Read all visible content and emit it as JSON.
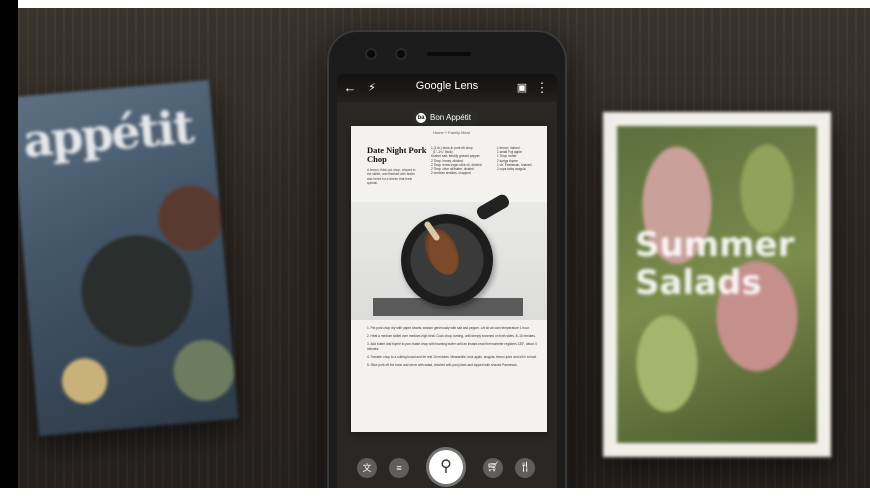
{
  "scene": {
    "left_magazine_title": "appétit",
    "right_magazine_title": "Summer Salads"
  },
  "app": {
    "title": "Google Lens",
    "back_icon": "arrow-left-icon",
    "flash_icon": "flash-off-icon",
    "gallery_icon": "gallery-icon",
    "menu_icon": "more-vert-icon"
  },
  "chip": {
    "logo": "ba",
    "label": "Bon Appétit"
  },
  "recipe": {
    "subheading": "Home + Family Meal",
    "title": "Date Night Pork Chop",
    "intro": "A brown, thick-cut chop, crisped in the skillet, and finished with butter and herbs for a dinner that feels special.",
    "ingredients_col1": "1 (1 lb.) bone-in pork rib chop\n  (1\"–1¼\" thick)\nKosher salt, freshly ground pepper\n2 Tbsp. honey, divided\n2 Tbsp. extra-virgin olive oil, divided\n2 Tbsp. olive oil/butter, divided\n2 medium shallots, chopped",
    "ingredients_col2": "1 lemon, halved\n1 small Fuji apple\n1 Tbsp. butter\n2 sprigs thyme\n1 oz. Parmesan, shaved\n2 cups baby arugula",
    "steps": [
      "1. Pat pork chop dry with paper towels; season generously with salt and pepper. Let sit at room temperature 1 hour.",
      "2. Heat a medium skillet over medium-high heat. Cook chop, turning, until deeply browned on both sides, 8–10 minutes.",
      "3. Add butter and thyme to pan; baste chop with foaming butter until an instant-read thermometer registers 135°, about 4 minutes.",
      "4. Transfer chop to a cutting board and let rest 10 minutes. Meanwhile, toss apple, arugula, lemon juice and oil in a bowl.",
      "5. Slice pork off the bone and serve with salad, drizzled with pan juices and topped with shaved Parmesan."
    ]
  },
  "toolbar": {
    "translate_icon": "translate-icon",
    "text_icon": "text-icon",
    "search_icon": "search-icon",
    "shopping_icon": "shopping-cart-icon",
    "dining_icon": "dining-icon"
  }
}
